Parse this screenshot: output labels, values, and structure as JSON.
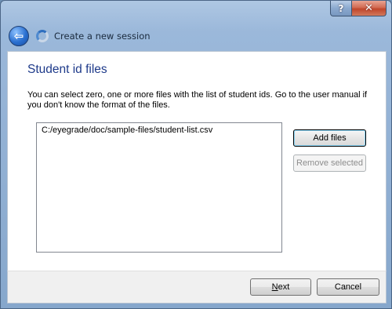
{
  "titlebar": {
    "help_label": "?",
    "close_label": "✕"
  },
  "wizard": {
    "title": "Create a new session"
  },
  "page": {
    "heading": "Student id files",
    "description": "You can select zero, one or more files with the list of student ids. Go to the user manual if you don't know the format of the files."
  },
  "file_list": {
    "items": [
      "C:/eyegrade/doc/sample-files/student-list.csv"
    ]
  },
  "buttons": {
    "add_files": "Add files",
    "remove_selected": "Remove selected",
    "next_mnemonic": "N",
    "next_rest": "ext",
    "cancel": "Cancel"
  }
}
